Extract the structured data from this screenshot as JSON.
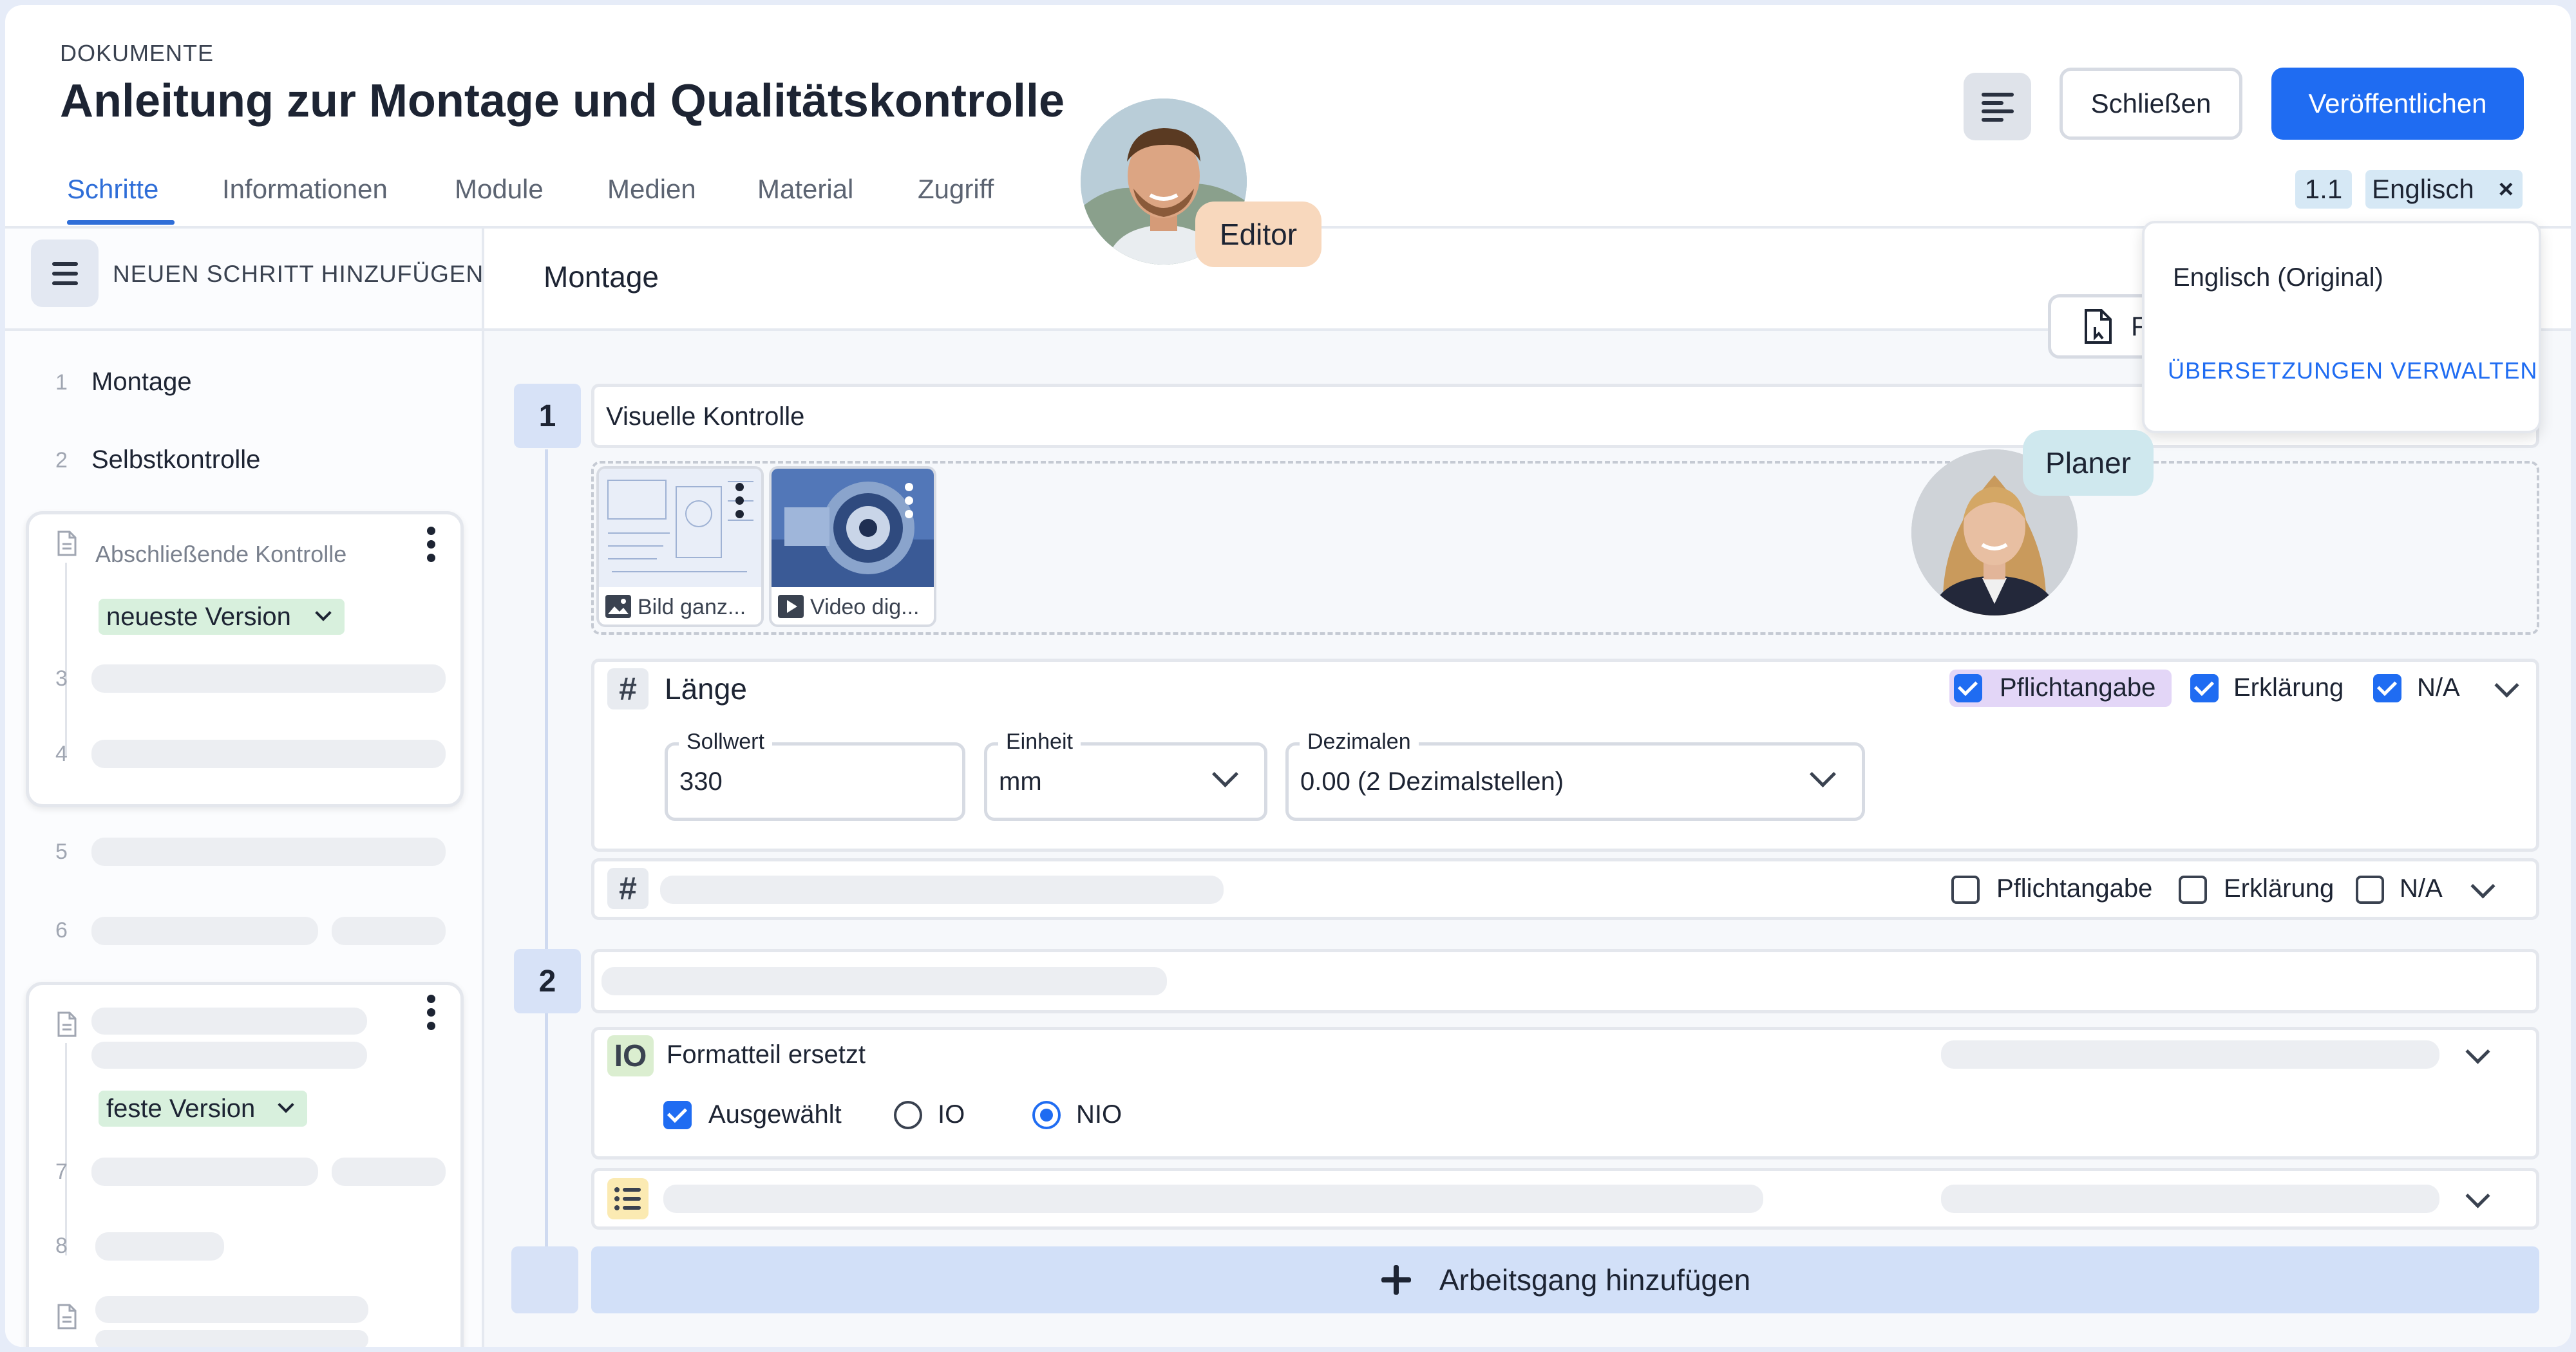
{
  "header": {
    "breadcrumb": "DOKUMENTE",
    "title": "Anleitung zur Montage und Qualitätskontrolle",
    "close_label": "Schließen",
    "publish_label": "Veröffentlichen",
    "version_chip": "1.1",
    "language_chip": "Englisch",
    "tabs": [
      {
        "label": "Schritte",
        "active": true
      },
      {
        "label": "Informationen"
      },
      {
        "label": "Module"
      },
      {
        "label": "Medien"
      },
      {
        "label": "Material"
      },
      {
        "label": "Zugriff"
      }
    ]
  },
  "language_dropdown": {
    "option": "Englisch (Original)",
    "manage": "ÜBERSETZUNGEN VERWALTEN"
  },
  "collaborators": {
    "editor": "Editor",
    "planer": "Planer"
  },
  "sidebar": {
    "add_step_label": "NEUEN SCHRITT HINZUFÜGEN",
    "items": [
      {
        "num": "1",
        "label": "Montage"
      },
      {
        "num": "2",
        "label": "Selbstkontrolle"
      }
    ],
    "module_card": {
      "title": "Abschließende Kontrolle",
      "version_tag": "neueste Version",
      "nums": [
        "3",
        "4"
      ]
    },
    "nums_after": [
      "5",
      "6"
    ],
    "module_card_2": {
      "version_tag": "feste Version",
      "nums": [
        "7",
        "8"
      ]
    }
  },
  "main": {
    "section_title": "Montage",
    "step1": {
      "num": "1",
      "title": "Visuelle Kontrolle",
      "media": [
        {
          "caption": "Bild ganz...",
          "kind": "image"
        },
        {
          "caption": "Video dig...",
          "kind": "video"
        }
      ],
      "field_length": {
        "icon": "#",
        "title": "Länge",
        "required_label": "Pflichtangabe",
        "explanation_label": "Erklärung",
        "na_label": "N/A",
        "target_label": "Sollwert",
        "target_value": "330",
        "unit_label": "Einheit",
        "unit_value": "mm",
        "decimals_label": "Dezimalen",
        "decimals_value": "0.00 (2 Dezimalstellen)"
      },
      "field_empty": {
        "icon": "#",
        "required_label": "Pflichtangabe",
        "explanation_label": "Erklärung",
        "na_label": "N/A"
      }
    },
    "step2": {
      "num": "2",
      "field_io": {
        "icon": "IO",
        "title": "Formatteil ersetzt",
        "selected_label": "Ausgewählt",
        "io_label": "IO",
        "nio_label": "NIO"
      }
    },
    "add_operation_label": "Arbeitsgang hinzufügen",
    "partial_button_label": "F"
  },
  "colors": {
    "primary": "#1f6cf2",
    "tab_active": "#2f6ed8",
    "green_tag": "#d8f0dd",
    "step_badge": "#d7e2f7",
    "required_highlight": "#e3d6f7",
    "editor_bubble": "#f8d8bd",
    "planer_bubble": "#cfe8ee"
  }
}
